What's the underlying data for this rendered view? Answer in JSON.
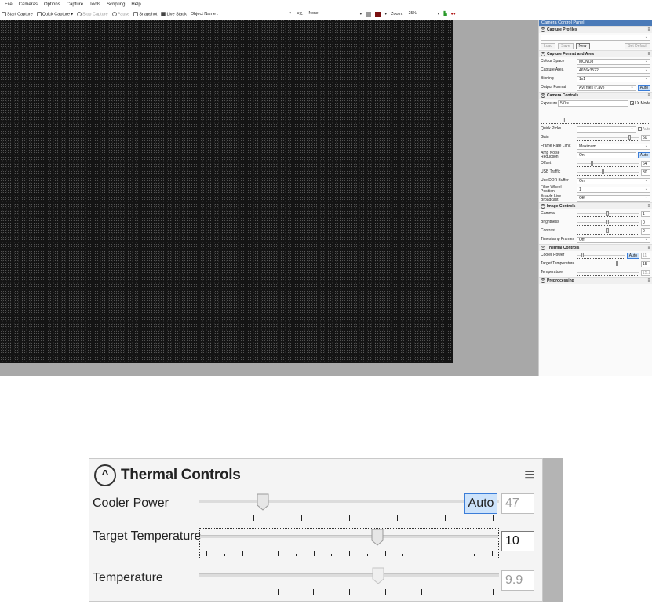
{
  "menu": [
    "File",
    "Cameras",
    "Options",
    "Capture",
    "Tools",
    "Scripting",
    "Help"
  ],
  "toolbar": {
    "start_capture": "Start Capture",
    "quick_capture": "Quick Capture",
    "stop_capture": "Stop Capture",
    "pause": "Pause",
    "snapshot": "Snapshot",
    "live_stack": "Live Stack",
    "object_name_label": "Object Name :",
    "fx_label": "FX:",
    "fx_value": "None",
    "zoom_label": "Zoom:",
    "zoom_value": "25%"
  },
  "panel": {
    "title": "Camera Control Panel",
    "sections": {
      "capture_profiles": "Capture Profiles",
      "capture_format": "Capture Format and Area",
      "camera_controls": "Camera Controls",
      "image_controls": "Image Controls",
      "thermal_controls": "Thermal Controls",
      "preprocessing": "Preprocessing"
    },
    "profile_buttons": {
      "load": "Load",
      "save": "Save",
      "new": "New",
      "set_default": "Set Default"
    },
    "format": {
      "colour_space_label": "Colour Space",
      "colour_space": "MONO8",
      "capture_area_label": "Capture Area",
      "capture_area": "4656x3522",
      "binning_label": "Binning",
      "binning": "1x1",
      "output_format_label": "Output Format",
      "output_format": "AVI files (*.avi)",
      "auto": "Auto"
    },
    "camera": {
      "exposure_label": "Exposure",
      "exposure": "5.0 s",
      "lx_mode": "LX Mode",
      "quick_picks_label": "Quick Picks",
      "quick_auto": "Auto",
      "gain_label": "Gain",
      "gain": "50",
      "frame_rate_label": "Frame Rate Limit",
      "frame_rate": "Maximum",
      "amp_noise_label": "Amp Noise Reduction",
      "amp_noise": "On",
      "amp_auto": "Auto",
      "offset_label": "Offset",
      "offset": "64",
      "usb_label": "USB Traffic",
      "usb": "30",
      "ddr_label": "Use DDR Buffer",
      "ddr": "On",
      "filter_label": "Filter Wheel Position",
      "filter": "1",
      "live_broadcast_label": "Enable Live Broadcast",
      "live_broadcast": "Off"
    },
    "image": {
      "gamma_label": "Gamma",
      "gamma": "1",
      "brightness_label": "Brightness",
      "brightness": "0",
      "contrast_label": "Contrast",
      "contrast": "0",
      "timestamp_label": "Timestamp Frames",
      "timestamp": "Off"
    },
    "thermal": {
      "cooler_label": "Cooler Power",
      "auto": "Auto",
      "cooler": "11",
      "target_label": "Target Temperature",
      "target": "15",
      "temperature_label": "Temperature",
      "temperature": "15.1"
    }
  },
  "zoom_panel": {
    "title": "Thermal Controls",
    "cooler_power": {
      "label": "Cooler Power",
      "auto_label": "Auto",
      "value": "47",
      "level": 0.2
    },
    "target_temperature": {
      "label": "Target Temperature",
      "value": "10",
      "level": 0.6
    },
    "temperature": {
      "label": "Temperature",
      "value": "9.9",
      "level": 0.6
    }
  },
  "colors": {
    "accent": "#3b7dd8",
    "auto_bg": "#cde3fb",
    "panel_title_bg": "#4a7ab8"
  }
}
